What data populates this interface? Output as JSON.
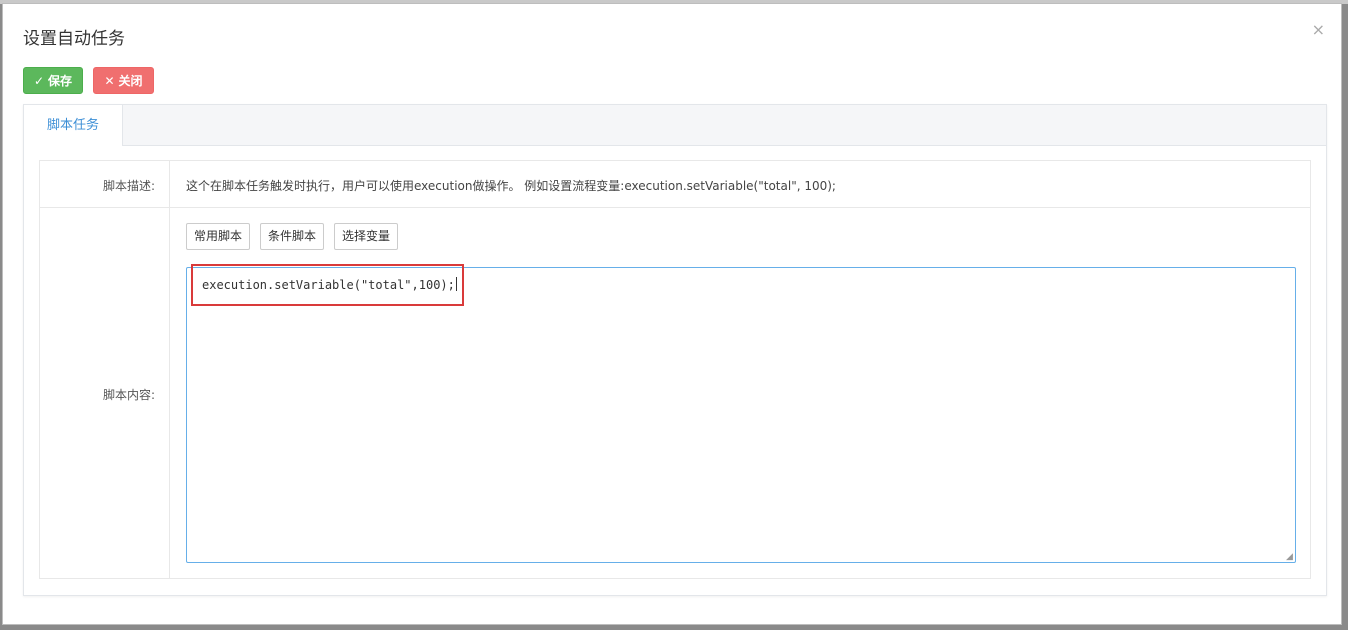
{
  "dialog": {
    "title": "设置自动任务",
    "close_glyph": "×"
  },
  "toolbar": {
    "save_label": "保存",
    "close_label": "关闭",
    "save_icon": "check-icon",
    "close_icon": "x-icon"
  },
  "tabs": [
    {
      "label": "脚本任务",
      "active": true
    }
  ],
  "form": {
    "desc_label": "脚本描述:",
    "desc_text": "这个在脚本任务触发时执行，用户可以使用execution做操作。 例如设置流程变量:execution.setVariable(\"total\", 100);",
    "content_label": "脚本内容:",
    "buttons": [
      "常用脚本",
      "条件脚本",
      "选择变量"
    ],
    "script_value": "execution.setVariable(\"total\",100);"
  },
  "colors": {
    "save": "#5cb85c",
    "close": "#f06f6f",
    "tab_active": "#3d8fd6",
    "editor_border": "#66afe9",
    "annotation": "#d93a3a"
  }
}
